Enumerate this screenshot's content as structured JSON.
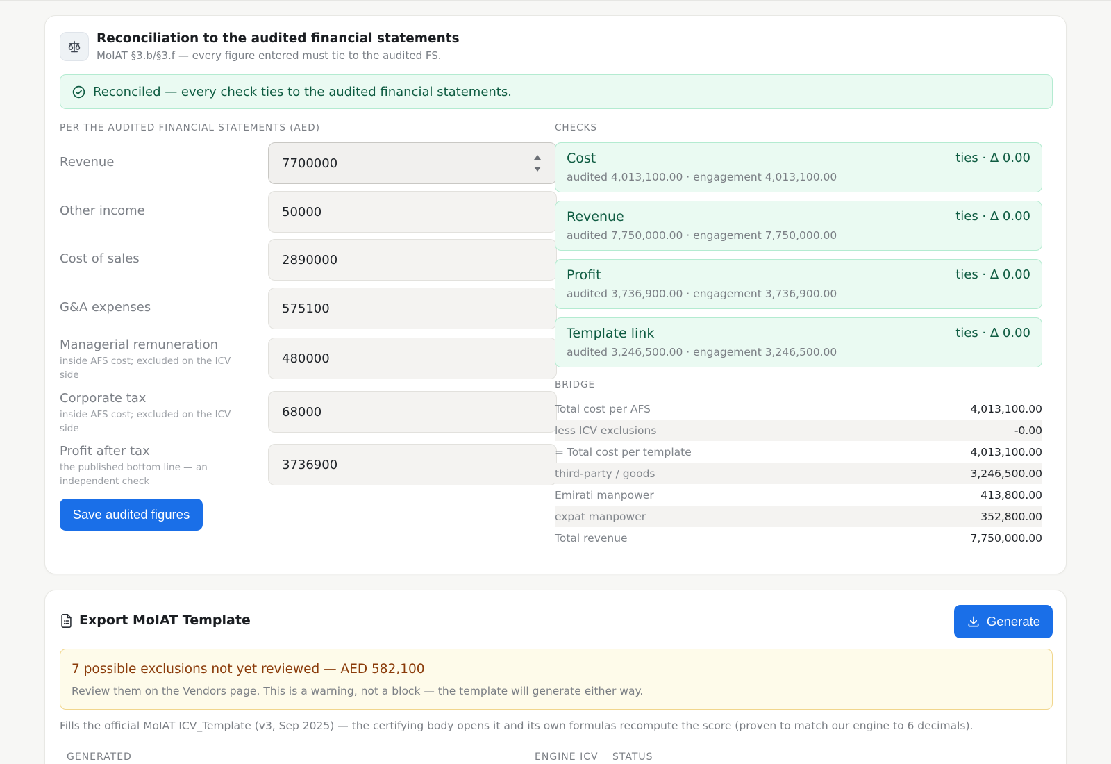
{
  "reconciliation": {
    "title": "Reconciliation to the audited financial statements",
    "subtitle": "MoIAT §3.b/§3.f — every figure entered must tie to the audited FS.",
    "banner": "Reconciled — every check ties to the audited financial statements.",
    "form_heading": "PER THE AUDITED FINANCIAL STATEMENTS (AED)",
    "fields": [
      {
        "label": "Revenue",
        "hint": "",
        "value": "7700000"
      },
      {
        "label": "Other income",
        "hint": "",
        "value": "50000"
      },
      {
        "label": "Cost of sales",
        "hint": "",
        "value": "2890000"
      },
      {
        "label": "G&A expenses",
        "hint": "",
        "value": "575100"
      },
      {
        "label": "Managerial remuneration",
        "hint": "inside AFS cost; excluded on the ICV side",
        "value": "480000"
      },
      {
        "label": "Corporate tax",
        "hint": "inside AFS cost; excluded on the ICV side",
        "value": "68000"
      },
      {
        "label": "Profit after tax",
        "hint": "the published bottom line — an independent check",
        "value": "3736900"
      }
    ],
    "save_label": "Save audited figures",
    "checks_heading": "CHECKS",
    "checks": [
      {
        "name": "Cost",
        "status": "ties · Δ 0.00",
        "detail": "audited 4,013,100.00 · engagement 4,013,100.00"
      },
      {
        "name": "Revenue",
        "status": "ties · Δ 0.00",
        "detail": "audited 7,750,000.00 · engagement 7,750,000.00"
      },
      {
        "name": "Profit",
        "status": "ties · Δ 0.00",
        "detail": "audited 3,736,900.00 · engagement 3,736,900.00"
      },
      {
        "name": "Template link",
        "status": "ties · Δ 0.00",
        "detail": "audited 3,246,500.00 · engagement 3,246,500.00"
      }
    ],
    "bridge_heading": "BRIDGE",
    "bridge": [
      {
        "label": "Total cost per AFS",
        "value": "4,013,100.00"
      },
      {
        "label": "less ICV exclusions",
        "value": "-0.00"
      },
      {
        "label": "= Total cost per template",
        "value": "4,013,100.00"
      },
      {
        "label": "third-party / goods",
        "value": "3,246,500.00"
      },
      {
        "label": "Emirati manpower",
        "value": "413,800.00"
      },
      {
        "label": "expat manpower",
        "value": "352,800.00"
      },
      {
        "label": "Total revenue",
        "value": "7,750,000.00"
      }
    ]
  },
  "export": {
    "title": "Export MoIAT Template",
    "generate_label": "Generate",
    "warning_title": "7 possible exclusions not yet reviewed — AED 582,100",
    "warning_body": "Review them on the Vendors page. This is a warning, not a block — the template will generate either way.",
    "note": "Fills the official MoIAT ICV_Template (v3, Sep 2025) — the certifying body opens it and its own formulas recompute the score (proven to match our engine to 6 decimals).",
    "columns": [
      "GENERATED",
      "ENGINE ICV",
      "STATUS"
    ]
  },
  "colors": {
    "accent": "#1a6fe8",
    "success_bg": "#eafaf2",
    "success_border": "#b4ebd1",
    "success_text": "#0f5c42",
    "warning_bg": "#fefbea",
    "warning_border": "#f1d68d",
    "warning_text": "#8a3b0a"
  },
  "icons": {
    "header": "scales-icon",
    "banner": "check-circle-icon",
    "export": "document-icon",
    "generate": "download-icon"
  }
}
